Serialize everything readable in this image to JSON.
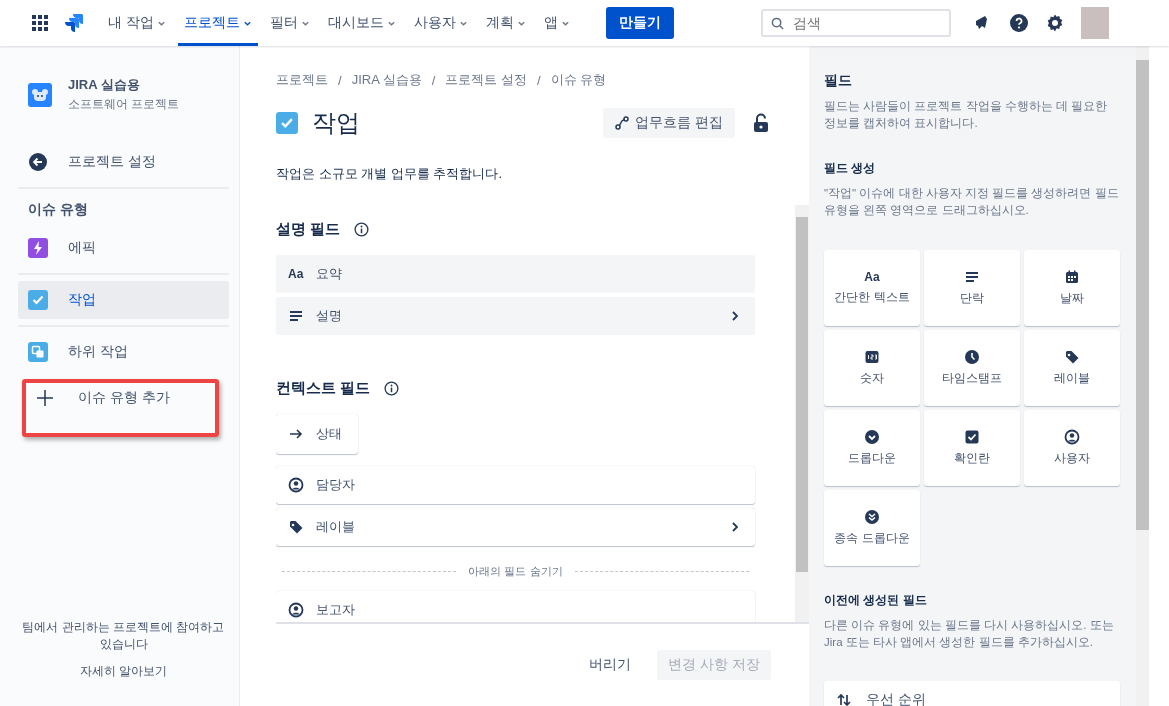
{
  "nav": {
    "items": [
      {
        "label": "내 작업",
        "selected": false
      },
      {
        "label": "프로젝트",
        "selected": true
      },
      {
        "label": "필터",
        "selected": false
      },
      {
        "label": "대시보드",
        "selected": false
      },
      {
        "label": "사용자",
        "selected": false
      },
      {
        "label": "계획",
        "selected": false
      },
      {
        "label": "앱",
        "selected": false
      }
    ],
    "create_button": "만들기",
    "search": {
      "placeholder": "검색"
    }
  },
  "sidebar": {
    "project": {
      "name": "JIRA 실습용",
      "type": "소프트웨어 프로젝트"
    },
    "back_link": "프로젝트 설정",
    "section_title": "이슈 유형",
    "items": [
      {
        "label": "에픽",
        "kind": "epic",
        "selected": false
      },
      {
        "label": "작업",
        "kind": "task",
        "selected": true
      },
      {
        "label": "하위 작업",
        "kind": "subtask",
        "selected": false
      }
    ],
    "add_item": {
      "label": "이슈 유형 추가",
      "highlighted": true
    },
    "footer": {
      "text": "팀에서 관리하는 프로젝트에 참여하고 있습니다",
      "link": "자세히 알아보기"
    }
  },
  "main": {
    "breadcrumbs": [
      "프로젝트",
      "JIRA 실습용",
      "프로젝트 설정",
      "이슈 유형"
    ],
    "breadcrumb_separator": "/",
    "title": "작업",
    "workflow_button": "업무흐름 편집",
    "description": "작업은 소규모 개별 업무를 추적합니다.",
    "sections": [
      {
        "title": "설명 필드",
        "kind": "locked",
        "fields": [
          {
            "label": "요약",
            "kind": "text",
            "glyph": "Aa",
            "chevron": false
          },
          {
            "label": "설명",
            "kind": "paragraph",
            "chevron": true
          }
        ]
      },
      {
        "title": "컨텍스트 필드",
        "kind": "context",
        "system_fields": [
          {
            "label": "상태",
            "kind": "arrow"
          }
        ],
        "fields": [
          {
            "label": "담당자",
            "kind": "user",
            "chevron": false
          },
          {
            "label": "레이블",
            "kind": "label",
            "chevron": true
          }
        ],
        "hidden_divider": "아래의 필드 숨기기",
        "hidden_fields": [
          {
            "label": "보고자",
            "kind": "user",
            "chevron": false
          }
        ]
      }
    ],
    "footer": {
      "discard": "버리기",
      "save": {
        "label": "변경 사항 저장",
        "disabled": true
      }
    }
  },
  "panel": {
    "title": "필드",
    "description": "필드는 사람들이 프로젝트 작업을 수행하는 데 필요한 정보를 캡처하여 표시합니다.",
    "create_title": "필드 생성",
    "create_description": "\"작업\" 이슈에 대한 사용자 지정 필드를 생성하려면 필드 유형을 왼쪽 영역으로 드래그하십시오.",
    "field_types": [
      {
        "label": "간단한 텍스트",
        "kind": "text",
        "glyph": "Aa"
      },
      {
        "label": "단락",
        "kind": "paragraph"
      },
      {
        "label": "날짜",
        "kind": "calendar"
      },
      {
        "label": "숫자",
        "kind": "number"
      },
      {
        "label": "타임스탬프",
        "kind": "clock"
      },
      {
        "label": "레이블",
        "kind": "label"
      },
      {
        "label": "드롭다운",
        "kind": "dropdown"
      },
      {
        "label": "확인란",
        "kind": "checkbox"
      },
      {
        "label": "사용자",
        "kind": "user"
      },
      {
        "label": "종속 드롭다운",
        "kind": "cascade"
      }
    ],
    "previous_title": "이전에 생성된 필드",
    "previous_description": "다른 이슈 유형에 있는 필드를 다시 사용하십시오. 또는 Jira 또는 타사 앱에서 생성한 필드를 추가하십시오.",
    "previous_fields": [
      {
        "label": "우선 순위",
        "kind": "priority"
      }
    ]
  }
}
